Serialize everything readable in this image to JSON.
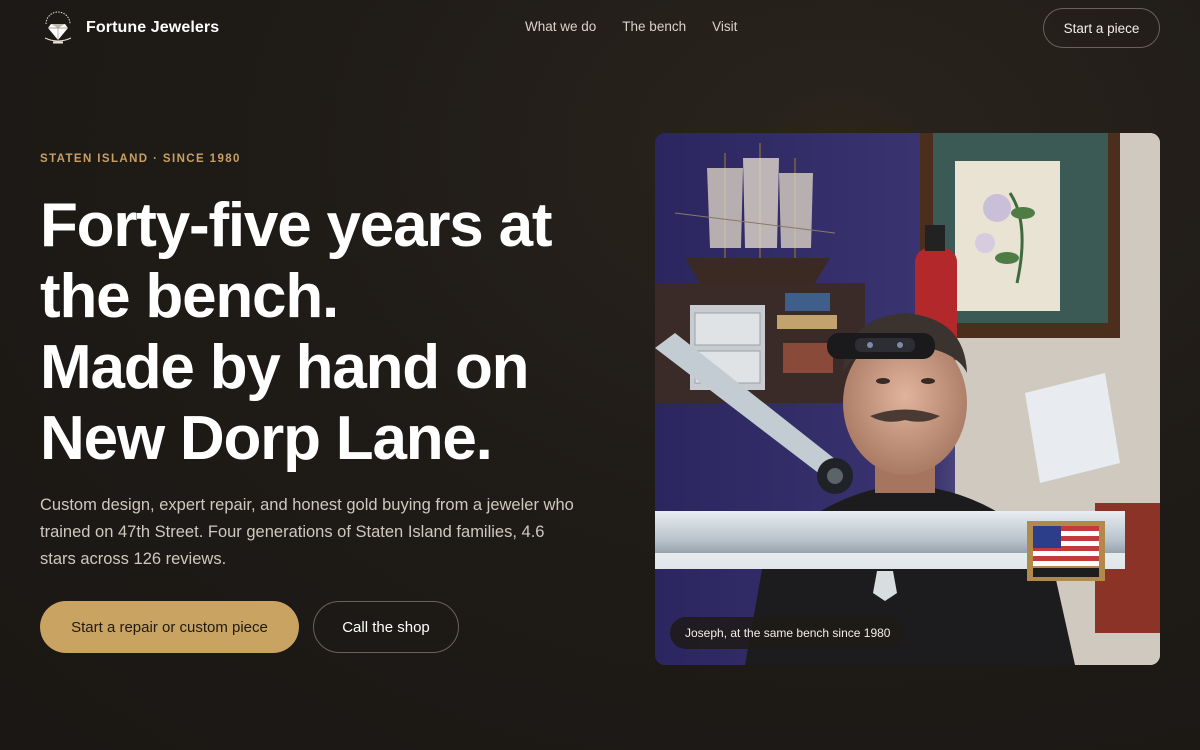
{
  "brand": {
    "name": "Fortune Jewelers"
  },
  "nav": {
    "items": [
      "What we do",
      "The bench",
      "Visit"
    ],
    "cta_label": "Start a piece"
  },
  "hero": {
    "eyebrow": "STATEN ISLAND · SINCE 1980",
    "headline_lines": [
      "Forty-five years at",
      "the bench.",
      "Made by hand on",
      "New Dorp Lane."
    ],
    "subtext": "Custom design, expert repair, and honest gold buying from a jeweler who trained on 47th Street. Four generations of Staten Island families, 4.6 stars across 126 reviews.",
    "primary_button": "Start a repair or custom piece",
    "secondary_button": "Call the shop"
  },
  "photo": {
    "caption": "Joseph, at the same bench since 1980",
    "alt": "Jeweler at his workbench wearing a head loupe"
  },
  "colors": {
    "background": "#1f1b17",
    "accent_gold": "#c9a362",
    "text": "#ffffff",
    "muted_text": "#cfc8be"
  },
  "icons": {
    "logo": "diamond-logo-icon"
  }
}
